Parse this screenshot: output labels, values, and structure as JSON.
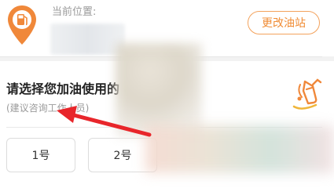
{
  "header": {
    "location_label": "当前位置:",
    "change_station_label": "更改油站"
  },
  "prompt": {
    "title": "请选择您加油使用的",
    "subtitle": "(建议咨询工作人员)"
  },
  "pumps": [
    {
      "label": "1号"
    },
    {
      "label": "2号"
    }
  ],
  "colors": {
    "accent": "#f08c35",
    "pin": "#f0883a",
    "annotation_arrow": "#e8262b"
  },
  "icons": {
    "location": "gas-station-pin-icon",
    "pump": "fuel-nozzle-icon"
  }
}
